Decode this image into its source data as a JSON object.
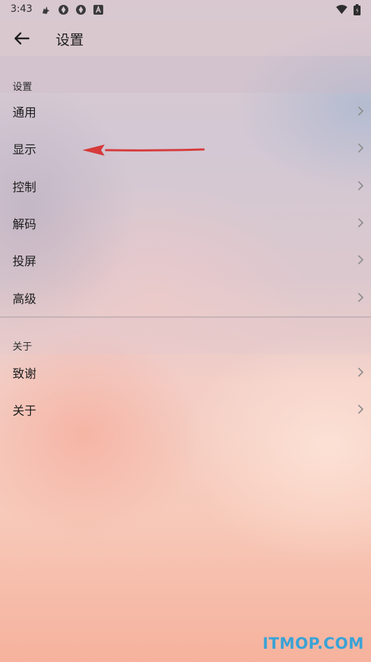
{
  "status_bar": {
    "time": "3:43",
    "icons": [
      "notification-bird-icon",
      "app-icon",
      "app-icon",
      "letter-a-icon",
      "wifi-icon",
      "battery-icon"
    ]
  },
  "app_bar": {
    "back_icon": "arrow-left-icon",
    "title": "设置"
  },
  "sections": [
    {
      "header": "设置",
      "items": [
        {
          "label": "通用"
        },
        {
          "label": "显示"
        },
        {
          "label": "控制"
        },
        {
          "label": "解码"
        },
        {
          "label": "投屏"
        },
        {
          "label": "高级"
        }
      ]
    },
    {
      "header": "关于",
      "items": [
        {
          "label": "致谢"
        },
        {
          "label": "关于"
        }
      ]
    }
  ],
  "annotation": {
    "arrow_color": "#d63a3a",
    "points_to": "显示"
  },
  "watermark": "ITMOP.COM",
  "colors": {
    "accent_watermark": "#3aa3d6",
    "text": "#1d1d1d",
    "chevron": "#8d8d8d"
  }
}
